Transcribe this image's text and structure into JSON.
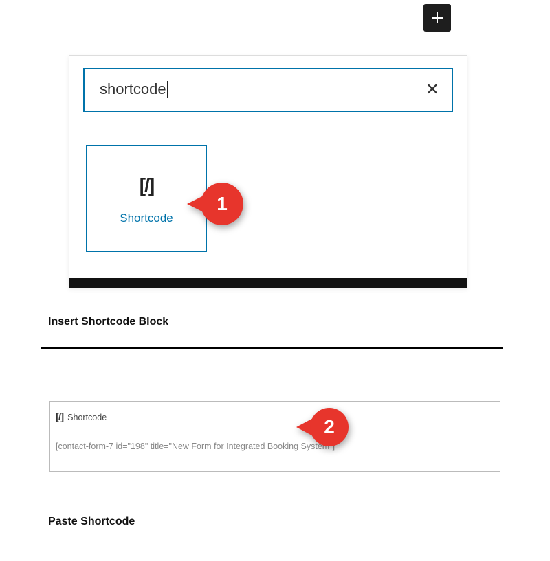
{
  "add_button": {
    "title": "Add block"
  },
  "inserter": {
    "search_value": "shortcode",
    "block": {
      "icon_text": "[/]",
      "label": "Shortcode"
    }
  },
  "callouts": {
    "one": "1",
    "two": "2"
  },
  "captions": {
    "insert": "Insert Shortcode Block",
    "paste": "Paste Shortcode"
  },
  "shortcode_block": {
    "icon_text": "[/]",
    "title": "Shortcode",
    "content": "[contact-form-7 id=\"198\" title=\"New Form for Integrated Booking System\"]"
  }
}
